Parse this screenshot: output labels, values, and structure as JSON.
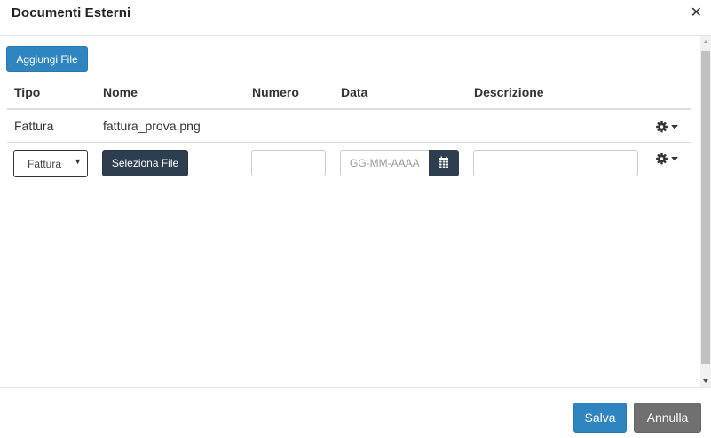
{
  "dialog": {
    "title": "Documenti Esterni",
    "close_icon": "close-icon"
  },
  "toolbar": {
    "add_file_label": "Aggiungi File"
  },
  "table": {
    "columns": [
      "Tipo",
      "Nome",
      "Numero",
      "Data",
      "Descrizione"
    ],
    "existing_row": {
      "tipo": "Fattura",
      "nome": "fattura_prova.png",
      "numero": "",
      "data": "",
      "descrizione": "",
      "actions_icon": "gear-icon"
    },
    "new_row": {
      "tipo_selected": "Fattura",
      "select_file_label": "Seleziona File",
      "numero_value": "",
      "data_placeholder": "GG-MM-AAAA",
      "calendar_icon": "calendar-icon",
      "descrizione_value": "",
      "actions_icon": "gear-icon"
    }
  },
  "footer": {
    "save_label": "Salva",
    "cancel_label": "Annulla"
  },
  "colors": {
    "primary": "#2e85c0",
    "dark": "#2e3e50",
    "cancel": "#707070"
  }
}
